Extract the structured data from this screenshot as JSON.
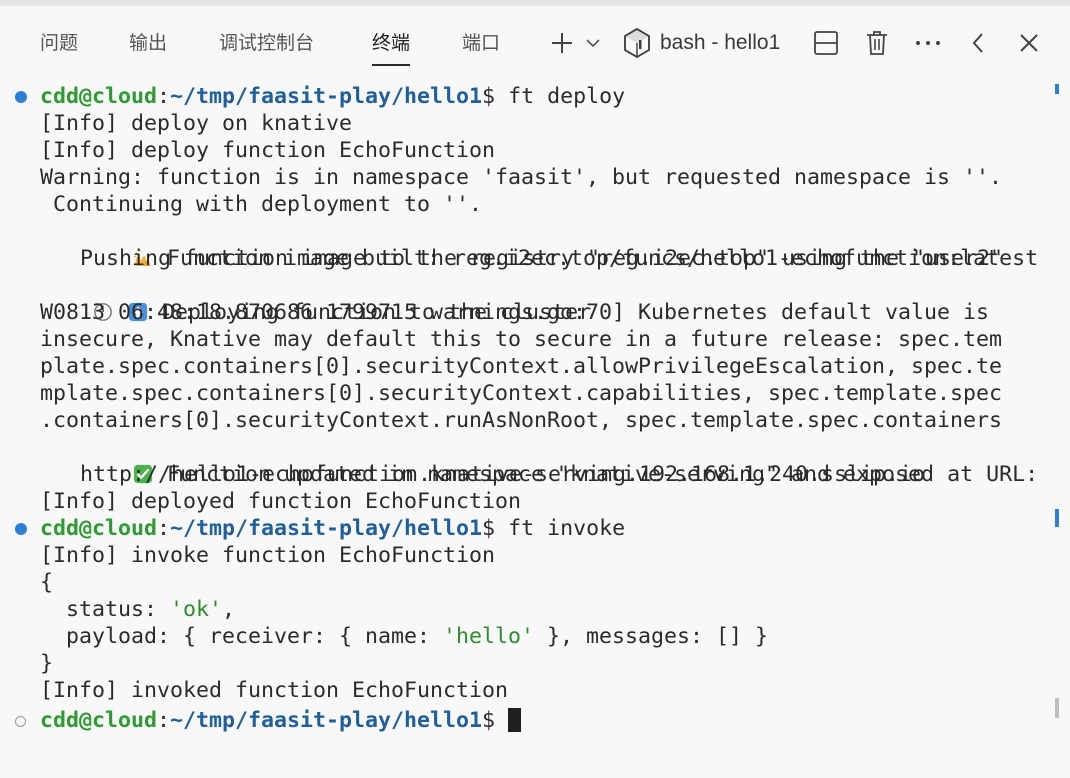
{
  "panel_tabs": [
    "问题",
    "输出",
    "调试控制台",
    "终端",
    "端口"
  ],
  "active_tab": "终端",
  "terminal_name": "bash - hello1",
  "icons": {
    "add": "plus-icon",
    "dropdown": "chevron-down-icon",
    "shell": "terminal-shell-icon",
    "split": "split-terminal-icon",
    "kill": "trash-icon",
    "more": "more-icon",
    "back": "chevron-left-icon",
    "close": "close-icon"
  },
  "prompt": {
    "user": "cdd@cloud",
    "path": "~/tmp/faasit-play/hello1",
    "symbol": "$"
  },
  "commands": [
    "ft deploy",
    "ft invoke"
  ],
  "output": {
    "l1": "[Info] deploy on knative",
    "l2": "[Info] deploy function EchoFunction",
    "l3": "Warning: function is in namespace 'faasit', but requested namespace is ''.",
    "l4": " Continuing with deployment to ''.",
    "l5": "Function image built: reg.i2ec.top/funcs/hello1-echofunction:latest",
    "l6": "Pushing function image to the registry \"reg.i2ec.top\" using the \"user2\"",
    "l7": "Deploying function to the cluster",
    "l8": "W0813 06:48:18.870686 1799715 warnings.go:70] Kubernetes default value is",
    "l9": "insecure, Knative may default this to secure in a future release: spec.tem",
    "l10": "plate.spec.containers[0].securityContext.allowPrivilegeEscalation, spec.te",
    "l11": "mplate.spec.containers[0].securityContext.capabilities, spec.template.spec",
    "l12": ".containers[0].securityContext.runAsNonRoot, spec.template.spec.containers",
    "l13": "Function updated in namespace \"knative-serving\" and exposed at URL:",
    "l14": "http://hello1-echofunction.knative-serving.192.168.1.240.sslip.io",
    "l15": "[Info] deployed function EchoFunction",
    "l16": "[Info] invoke function EchoFunction",
    "l17": "{",
    "l18_key": "  status: ",
    "l18_val": "'ok'",
    "l18_end": ",",
    "l19_a": "  payload: { receiver: { name: ",
    "l19_val": "'hello'",
    "l19_b": " }, messages: [] }",
    "l20": "}",
    "l21": "[Info] invoked function EchoFunction"
  },
  "colors": {
    "prompt_user": "#2d9a32",
    "prompt_path": "#1f5f9e",
    "string": "#2d8d2d",
    "success_dot": "#2b7fd6"
  }
}
